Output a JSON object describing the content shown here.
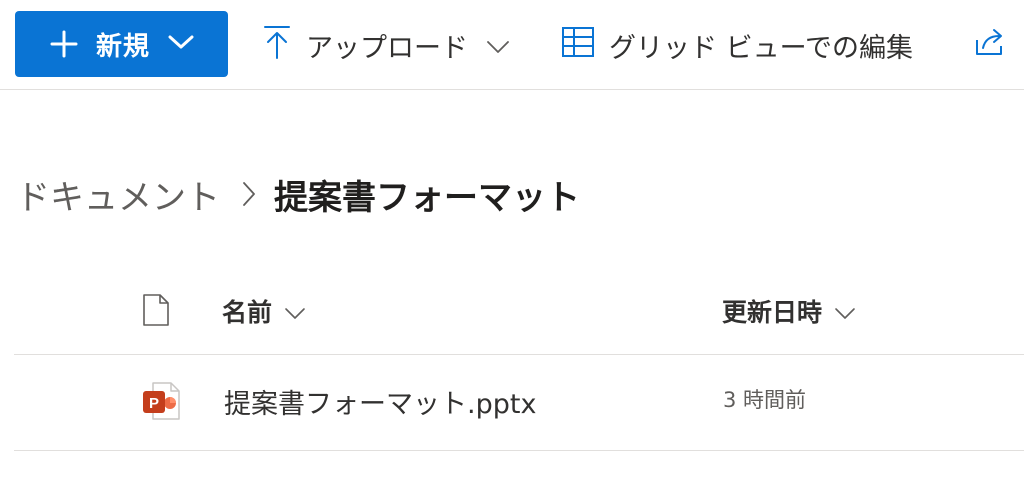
{
  "toolbar": {
    "new_label": "新規",
    "upload_label": "アップロード",
    "grid_label": "グリッド ビューでの編集",
    "accent_color": "#0a74d4",
    "icons": {
      "new": "plus-icon",
      "new_dropdown": "chevron-down-icon",
      "upload": "upload-arrow-icon",
      "upload_dropdown": "chevron-down-icon",
      "grid": "grid-table-icon",
      "share": "share-icon"
    }
  },
  "breadcrumb": {
    "parent": "ドキュメント",
    "current": "提案書フォーマット",
    "separator_icon": "chevron-right-icon"
  },
  "list": {
    "header": {
      "file_type_icon": "document-icon",
      "name_label": "名前",
      "modified_label": "更新日時"
    },
    "rows": [
      {
        "icon": "powerpoint-file-icon",
        "name": "提案書フォーマット.pptx",
        "modified": "3 時間前"
      }
    ]
  }
}
